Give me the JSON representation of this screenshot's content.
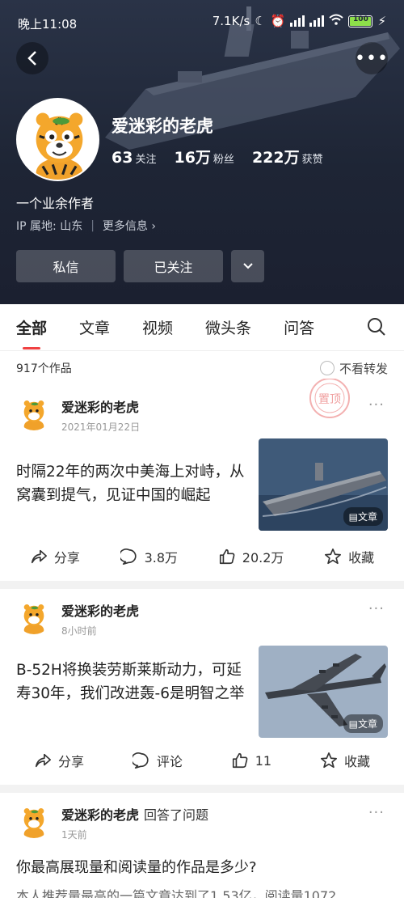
{
  "status_bar": {
    "time": "晚上11:08",
    "speed": "7.1K/s",
    "battery": "100"
  },
  "profile": {
    "name": "爱迷彩的老虎",
    "stats": [
      {
        "value": "63",
        "label": "关注"
      },
      {
        "value": "16万",
        "label": "粉丝"
      },
      {
        "value": "222万",
        "label": "获赞"
      }
    ],
    "bio": "一个业余作者",
    "ip_location": "IP 属地: 山东",
    "more_info": "更多信息 ›",
    "message_button": "私信",
    "follow_button": "已关注"
  },
  "tabs": [
    "全部",
    "文章",
    "视频",
    "微头条",
    "问答"
  ],
  "filter": {
    "works_count": "917个作品",
    "no_repost": "不看转发"
  },
  "feed": [
    {
      "author": "爱迷彩的老虎",
      "time": "2021年01月22日",
      "stamp": "置顶",
      "title": "时隔22年的两次中美海上对峙，从窝囊到提气，见证中国的崛起",
      "thumb_tag": "文章",
      "actions": {
        "share": "分享",
        "comment": "3.8万",
        "like": "20.2万",
        "favorite": "收藏"
      }
    },
    {
      "author": "爱迷彩的老虎",
      "time": "8小时前",
      "title": "B-52H将换装劳斯莱斯动力，可延寿30年，我们改进轰-6是明智之举",
      "thumb_tag": "文章",
      "actions": {
        "share": "分享",
        "comment": "评论",
        "like": "11",
        "favorite": "收藏"
      }
    },
    {
      "author": "爱迷彩的老虎",
      "extra": "回答了问题",
      "time": "1天前",
      "title": "你最高展现量和阅读量的作品是多少?",
      "body": "本人推荐量最高的一篇文章达到了1.53亿，阅读量1072"
    }
  ]
}
